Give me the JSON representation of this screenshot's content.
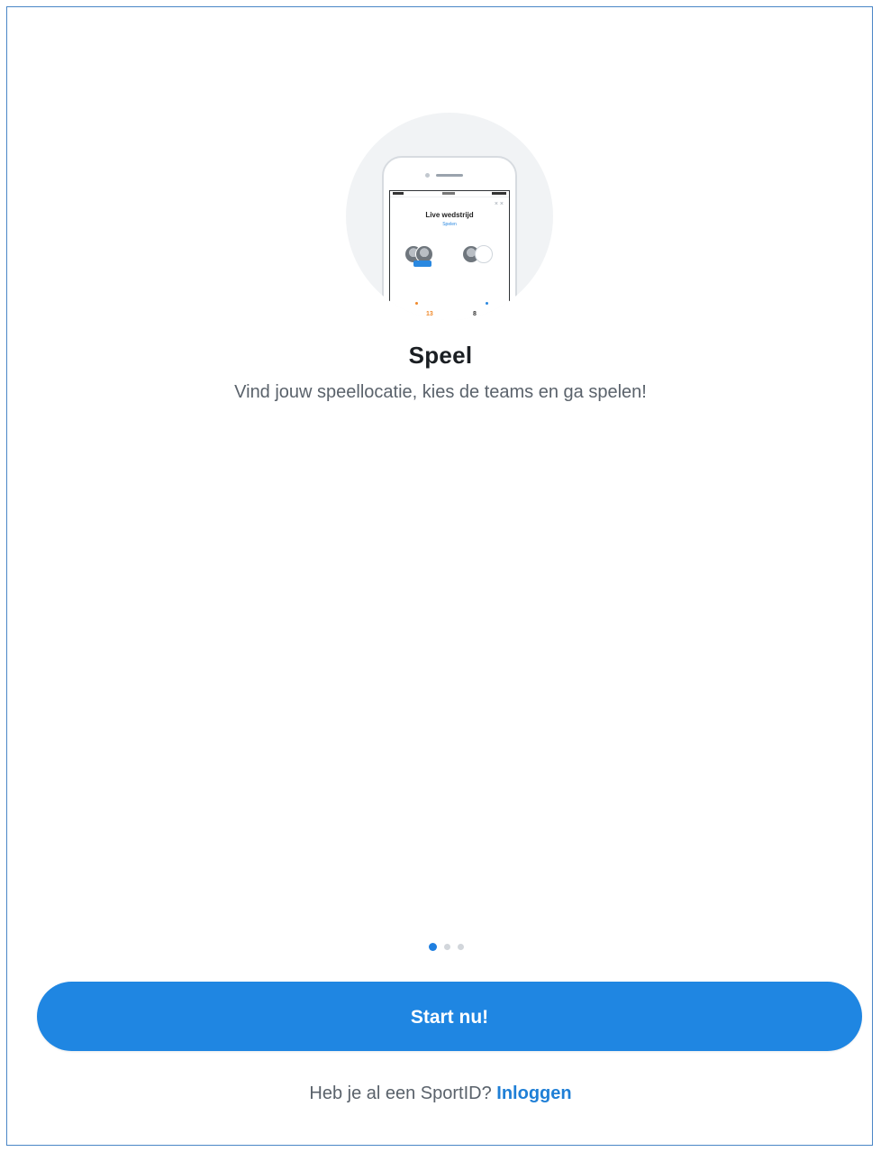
{
  "illustration": {
    "icon": "phone-live-match-icon",
    "screen_title": "Live wedstrijd",
    "screen_subtitle": "Spelen",
    "badge": "",
    "mid_text": "",
    "score_left": "13",
    "score_right": "8",
    "close_glyph": "× ×"
  },
  "onboarding": {
    "title": "Speel",
    "description": "Vind jouw speellocatie, kies de teams en ga spelen!"
  },
  "pagination": {
    "current_page": 1,
    "total_pages": 3
  },
  "cta": {
    "label": "Start nu!"
  },
  "login": {
    "prompt": "Heb je al een SportID?",
    "link_label": "Inloggen"
  },
  "colors": {
    "accent": "#1f86e2",
    "frame_border": "#4a86c6",
    "text_primary": "#1b1f23",
    "text_secondary": "#5a626b"
  }
}
